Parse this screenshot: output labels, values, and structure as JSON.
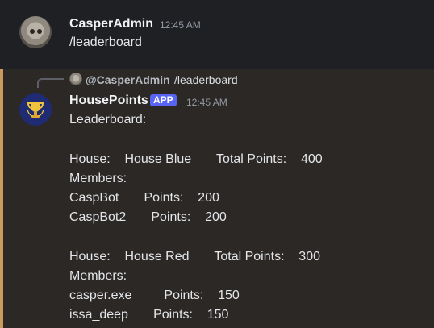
{
  "messages": {
    "user": {
      "username": "CasperAdmin",
      "timestamp": "12:45 AM",
      "text": "/leaderboard",
      "avatar_icon": "cat-avatar-icon"
    },
    "bot": {
      "reply_preview": {
        "mention": "@CasperAdmin",
        "text": "/leaderboard"
      },
      "name": "HousePoints",
      "badge": "APP",
      "timestamp": "12:45 AM",
      "avatar_icon": "trophy-icon",
      "lines": [
        "Leaderboard:",
        "House:    House Blue       Total Points:    400",
        "Members:",
        "CaspBot       Points:    200",
        "CaspBot2       Points:    200",
        "House:    House Red       Total Points:    300",
        "Members:",
        "casper.exe_       Points:    150",
        "issa_deep       Points:    150"
      ]
    }
  },
  "colors": {
    "background": "#1e1f22",
    "bot_message_background": "#2b2826",
    "highlight_bar": "#cc9a5f",
    "app_badge": "#5865f2",
    "bot_avatar": "#1f2b72",
    "text_primary": "#dbdee1",
    "text_muted": "#949ba4"
  }
}
